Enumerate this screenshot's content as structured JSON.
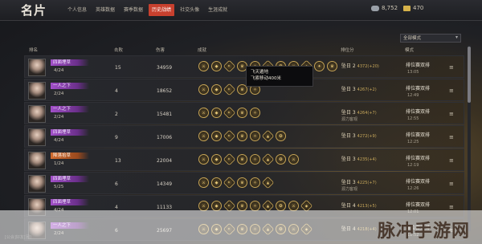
{
  "header": {
    "title": "名片",
    "tabs": [
      "个人信息",
      "英雄数据",
      "赛季数据",
      "历史战绩",
      "社交头像",
      "生涯成就"
    ],
    "active_tab_index": 3,
    "currency": [
      {
        "icon": "coin-icon",
        "value": "8,752"
      },
      {
        "icon": "gold-icon",
        "value": "470"
      }
    ]
  },
  "filter": {
    "selected": "全部模式"
  },
  "table": {
    "columns": [
      "排名",
      "击败",
      "伤害",
      "成就",
      "排位分",
      "模式"
    ],
    "rows": [
      {
        "name": "四面埋草",
        "badge": "purple",
        "rank": "4/24",
        "kills": "15",
        "damage": "34959",
        "achievements": [
          "⚔",
          "◆",
          "✦",
          "♛",
          "✧",
          "▲",
          "✪",
          "⚔",
          "◆",
          "✦",
          "♛"
        ],
        "tier": "坠日 2",
        "points": "4372(+20)",
        "tier_sub": "",
        "mode": "排位赛双排",
        "time": "13:05"
      },
      {
        "name": "一人之下",
        "badge": "purple",
        "rank": "2/24",
        "kills": "4",
        "damage": "18652",
        "achievements": [
          "⚔",
          "◆",
          "✦",
          "♛",
          "✧"
        ],
        "tier": "坠日 3",
        "points": "4267(+2)",
        "tier_sub": "",
        "mode": "排位赛双排",
        "time": "12:49"
      },
      {
        "name": "一人之下",
        "badge": "purple",
        "rank": "2/24",
        "kills": "2",
        "damage": "15481",
        "achievements": [
          "⚔",
          "◆",
          "✦",
          "♛",
          "✧"
        ],
        "tier": "坠日 3",
        "points": "4264(+7)",
        "tier_sub": "源力客观",
        "mode": "排位赛双排",
        "time": "12:55"
      },
      {
        "name": "四面埋草",
        "badge": "purple",
        "rank": "4/24",
        "kills": "9",
        "damage": "17006",
        "achievements": [
          "⚔",
          "◆",
          "✦",
          "♛",
          "✧",
          "▲",
          "✪"
        ],
        "tier": "坠日 3",
        "points": "4272(+9)",
        "tier_sub": "",
        "mode": "排位赛双排",
        "time": "12:25"
      },
      {
        "name": "降落拾草",
        "badge": "orange",
        "rank": "1/24",
        "kills": "13",
        "damage": "22004",
        "achievements": [
          "⚔",
          "◆",
          "✦",
          "♛",
          "✧",
          "▲",
          "✪",
          "⚔"
        ],
        "tier": "坠日 3",
        "points": "4235(+4)",
        "tier_sub": "",
        "mode": "排位赛双排",
        "time": "12:19"
      },
      {
        "name": "四面埋草",
        "badge": "purple",
        "rank": "5/25",
        "kills": "6",
        "damage": "14349",
        "achievements": [
          "⚔",
          "◆",
          "✦",
          "♛",
          "✧",
          "▲"
        ],
        "tier": "坠日 3",
        "points": "4225(+7)",
        "tier_sub": "源力客观",
        "mode": "排位赛双排",
        "time": "12:26"
      },
      {
        "name": "四面埋草",
        "badge": "purple",
        "rank": "4/24",
        "kills": "4",
        "damage": "11133",
        "achievements": [
          "⚔",
          "◆",
          "✦",
          "♛",
          "✧",
          "▲",
          "✪",
          "⚔",
          "◆"
        ],
        "tier": "坠日 4",
        "points": "4213(+5)",
        "tier_sub": "",
        "mode": "排位赛双排",
        "time": "12:01"
      },
      {
        "name": "一人之下",
        "badge": "purple",
        "rank": "2/24",
        "kills": "6",
        "damage": "25697",
        "achievements": [
          "⚔",
          "◆",
          "✦",
          "♛",
          "✧",
          "▲",
          "✪",
          "⚔",
          "◆"
        ],
        "tier": "坠日 4",
        "points": "4218(+4)",
        "tier_sub": "",
        "mode": "排位赛双排",
        "time": "11:52"
      }
    ]
  },
  "tooltip": {
    "title": "飞天遁地",
    "desc": "飞索移动400米"
  },
  "footer": {
    "status": "[公会]好友[团]"
  },
  "watermark": "脉冲手游网"
}
